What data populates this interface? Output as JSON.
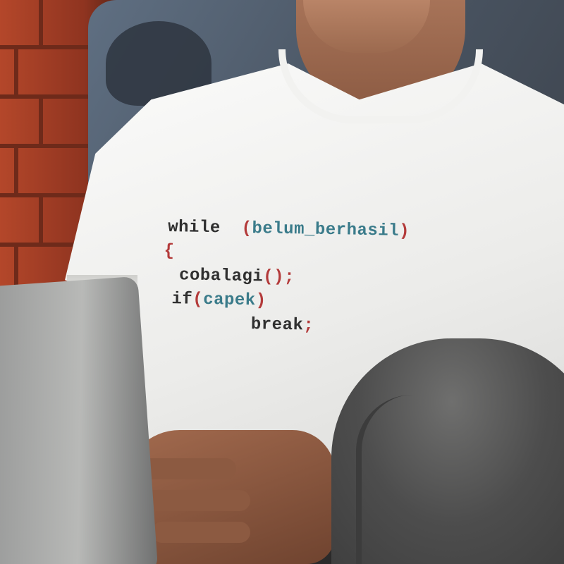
{
  "scene": {
    "description_free": true
  },
  "shirt_print": {
    "lines": [
      {
        "keyword": "while",
        "open": "(",
        "variable": "belum_berhasil",
        "close": ")"
      },
      {
        "brace": "{"
      },
      {
        "function": "cobalagi",
        "parens": "()",
        "semicolon": ";"
      },
      {
        "keyword": "if",
        "open": "(",
        "variable": "capek",
        "close": ")"
      },
      {
        "keyword": "break",
        "semicolon": ";"
      }
    ]
  },
  "colors": {
    "keyword": "#2f2f2f",
    "variable": "#3a7b8a",
    "punctuation": "#b33a3a",
    "shirt": "#f2f2f0",
    "brick": "#9c3b22",
    "chair": "#4a5563"
  }
}
